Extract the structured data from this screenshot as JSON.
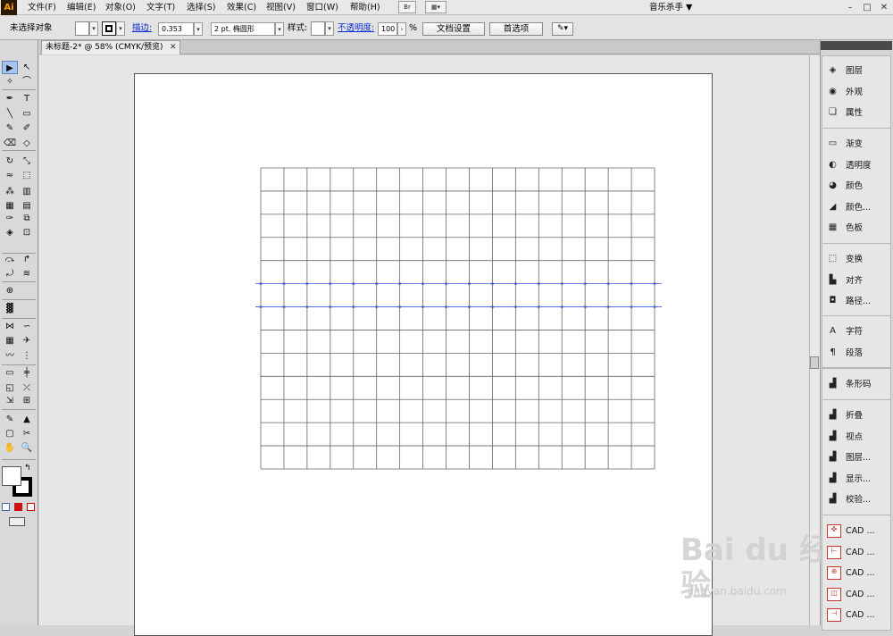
{
  "app": {
    "logo": "Ai",
    "menus": [
      "文件(F)",
      "编辑(E)",
      "对象(O)",
      "文字(T)",
      "选择(S)",
      "效果(C)",
      "视图(V)",
      "窗口(W)",
      "帮助(H)"
    ],
    "bridge_button": "Br",
    "workspace": "音乐杀手 ▼",
    "window_controls": [
      "–",
      "□",
      "✕"
    ]
  },
  "control_bar": {
    "selection": "未选择对象",
    "stroke_label": "描边:",
    "stroke_weight": "0.353",
    "brush": "2 pt. 椭圆形",
    "style_label": "样式:",
    "opacity_label": "不透明度:",
    "opacity_value": "100",
    "opacity_unit": "%",
    "doc_setup": "文档设置",
    "preferences": "首选项"
  },
  "document": {
    "tab_title": "未标题-2* @ 58% (CMYK/预览)",
    "tab_close": "✕"
  },
  "grid": {
    "columns": 17,
    "rows": 13,
    "guides": [
      5,
      6
    ],
    "line_color": "#666666",
    "guide_color": "#3a57d6"
  },
  "panels": {
    "group1": [
      {
        "icon": "layers-icon",
        "glyph": "◈",
        "label": "图层"
      },
      {
        "icon": "appearance-icon",
        "glyph": "◉",
        "label": "外观"
      },
      {
        "icon": "attributes-icon",
        "glyph": "❏",
        "label": "属性"
      }
    ],
    "group2": [
      {
        "icon": "gradient-icon",
        "glyph": "▭",
        "label": "渐变"
      },
      {
        "icon": "transparency-icon",
        "glyph": "◐",
        "label": "透明度"
      },
      {
        "icon": "color-icon",
        "glyph": "◕",
        "label": "颜色"
      },
      {
        "icon": "color-guide-icon",
        "glyph": "◢",
        "label": "颜色..."
      },
      {
        "icon": "swatches-icon",
        "glyph": "▦",
        "label": "色板"
      }
    ],
    "group3": [
      {
        "icon": "transform-icon",
        "glyph": "⬚",
        "label": "变换"
      },
      {
        "icon": "align-icon",
        "glyph": "▙",
        "label": "对齐"
      },
      {
        "icon": "pathfinder-icon",
        "glyph": "◘",
        "label": "路径..."
      }
    ],
    "group4": [
      {
        "icon": "character-icon",
        "glyph": "A",
        "label": "字符"
      },
      {
        "icon": "paragraph-icon",
        "glyph": "¶",
        "label": "段落"
      }
    ],
    "group5": [
      {
        "icon": "barcode-icon",
        "glyph": "▟",
        "label": "条形码"
      }
    ],
    "group6": [
      {
        "icon": "fold-icon",
        "glyph": "▟",
        "label": "折叠"
      },
      {
        "icon": "view-icon",
        "glyph": "▟",
        "label": "视点"
      },
      {
        "icon": "layer2-icon",
        "glyph": "▟",
        "label": "图层..."
      },
      {
        "icon": "display-icon",
        "glyph": "▟",
        "label": "显示..."
      },
      {
        "icon": "check-icon",
        "glyph": "▟",
        "label": "校验..."
      }
    ],
    "group7": [
      {
        "icon": "cad-icon",
        "glyph": "✜",
        "label": "CAD ..."
      },
      {
        "icon": "cad-icon",
        "glyph": "⊢",
        "label": "CAD ..."
      },
      {
        "icon": "cad-icon",
        "glyph": "⊕",
        "label": "CAD ..."
      },
      {
        "icon": "cad-icon",
        "glyph": "◫",
        "label": "CAD ..."
      },
      {
        "icon": "cad-icon",
        "glyph": "⊣",
        "label": "CAD ..."
      }
    ]
  },
  "watermark": {
    "text": "Bai du 经验",
    "url": "jingyan.baidu.com"
  }
}
